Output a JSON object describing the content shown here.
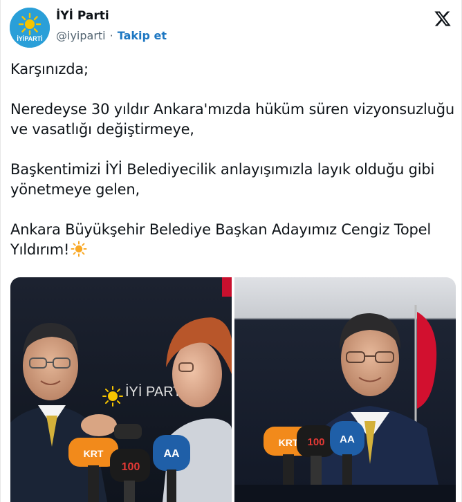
{
  "author": {
    "name": "İYİ Parti",
    "handle": "@iyiparti",
    "separator": "·",
    "follow_label": "Takip et",
    "avatar_icon": "iyi-parti-sun-logo",
    "avatar_text": "İYİPARTİ"
  },
  "platform_logo": "x-logo",
  "tweet": {
    "paragraphs": [
      "Karşınızda;",
      "Neredeyse 30 yıldır Ankara'mızda hüküm süren vizyonsuzluğu ve vasatlığı değiştirmeye,",
      "Başkentimizi İYİ Belediyecilik anlayışımızla layık olduğu gibi yönetmeye gelen,",
      "Ankara Büyükşehir Belediye Başkan Adayımız Cengiz Topel Yıldırım!"
    ],
    "emoji": "sun-emoji"
  },
  "media": {
    "photos": [
      {
        "name": "photo-candidate-with-leader",
        "mic_labels": [
          "KRT",
          "100",
          "AA"
        ],
        "backdrop": "İYİ PARTİ"
      },
      {
        "name": "photo-candidate-at-podium",
        "mic_labels": [
          "KRT",
          "100",
          "AA"
        ]
      }
    ]
  },
  "colors": {
    "link": "#1d77c2",
    "secondary_text": "#536471",
    "brand_blue": "#2a9fd8",
    "brand_yellow": "#f6b800"
  }
}
